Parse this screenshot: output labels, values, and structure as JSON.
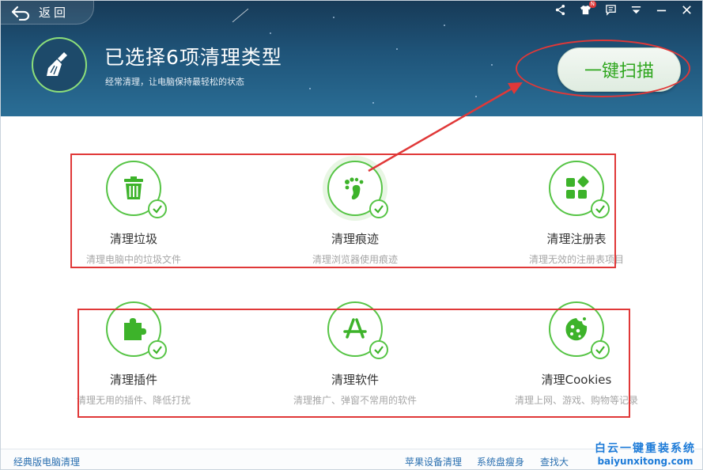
{
  "header": {
    "back_label": "返回",
    "title": "已选择6项清理类型",
    "subtitle": "经常清理，让电脑保持最轻松的状态",
    "scan_button": "一键扫描",
    "topbar_icons": [
      "share-icon",
      "shirt-icon",
      "message-icon",
      "menu-icon",
      "minimize-icon",
      "close-icon"
    ],
    "badge": "N"
  },
  "items": [
    {
      "title": "清理垃圾",
      "desc": "清理电脑中的垃圾文件",
      "icon": "trash-icon"
    },
    {
      "title": "清理痕迹",
      "desc": "清理浏览器使用痕迹",
      "icon": "footprint-icon"
    },
    {
      "title": "清理注册表",
      "desc": "清理无效的注册表项目",
      "icon": "blocks-icon"
    },
    {
      "title": "清理插件",
      "desc": "清理无用的插件、降低打扰",
      "icon": "puzzle-icon"
    },
    {
      "title": "清理软件",
      "desc": "清理推广、弹窗不常用的软件",
      "icon": "appstore-icon"
    },
    {
      "title": "清理Cookies",
      "desc": "清理上网、游戏、购物等记录",
      "icon": "cookie-icon"
    }
  ],
  "footer": {
    "classic_link": "经典版电脑清理",
    "apple_link": "苹果设备清理",
    "disk_link": "系统盘瘦身",
    "search_link": "查找大",
    "watermark_cn": "白云一键重装系统",
    "watermark_en": "baiyunxitong.com"
  },
  "colors": {
    "accent_green": "#56c445",
    "annotation_red": "#e03838",
    "header_blue": "#1f5479"
  }
}
